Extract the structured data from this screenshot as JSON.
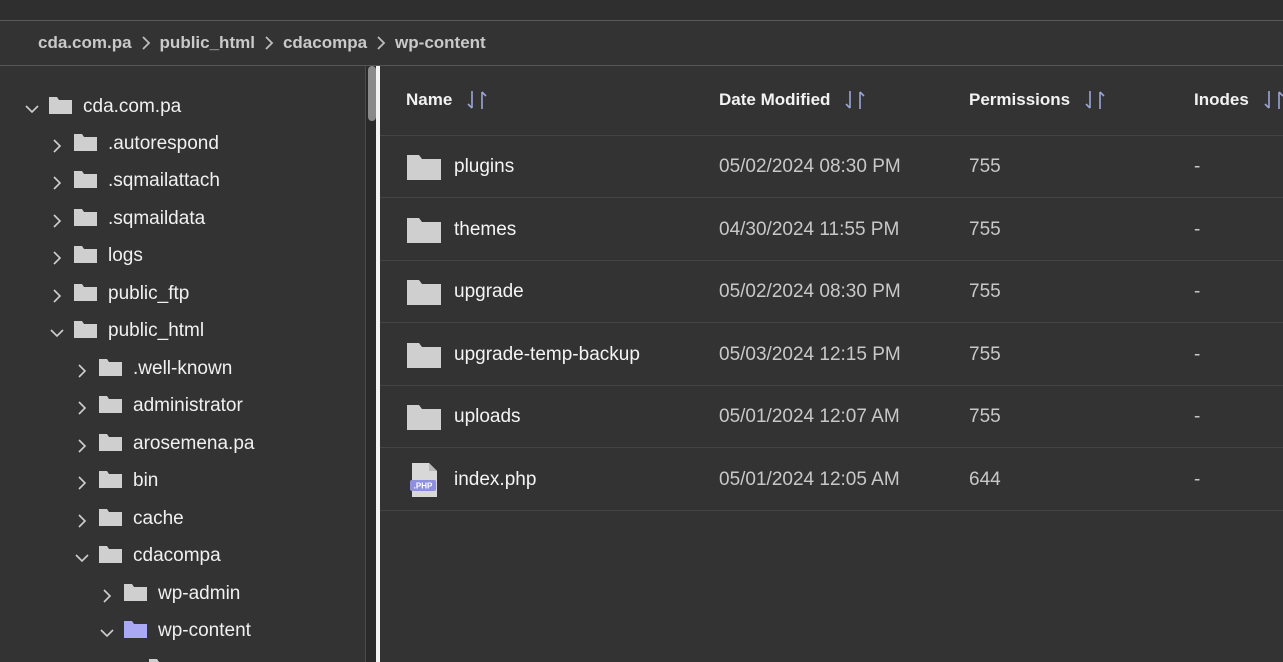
{
  "breadcrumb": [
    {
      "label": "cda.com.pa"
    },
    {
      "label": "public_html"
    },
    {
      "label": "cdacompa"
    },
    {
      "label": "wp-content"
    }
  ],
  "tree": [
    {
      "label": "cda.com.pa",
      "expanded": true
    },
    {
      "label": ".autorespond",
      "expanded": false
    },
    {
      "label": ".sqmailattach",
      "expanded": false
    },
    {
      "label": ".sqmaildata",
      "expanded": false
    },
    {
      "label": "logs",
      "expanded": false
    },
    {
      "label": "public_ftp",
      "expanded": false
    },
    {
      "label": "public_html",
      "expanded": true
    },
    {
      "label": ".well-known",
      "expanded": false
    },
    {
      "label": "administrator",
      "expanded": false
    },
    {
      "label": "arosemena.pa",
      "expanded": false
    },
    {
      "label": "bin",
      "expanded": false
    },
    {
      "label": "cache",
      "expanded": false
    },
    {
      "label": "cdacompa",
      "expanded": true
    },
    {
      "label": "wp-admin",
      "expanded": false
    },
    {
      "label": "wp-content",
      "expanded": true,
      "selected": true
    },
    {
      "label": "",
      "expanded": false
    }
  ],
  "table": {
    "columns": {
      "name": "Name",
      "date": "Date Modified",
      "permissions": "Permissions",
      "inodes": "Inodes"
    },
    "rows": [
      {
        "name": "plugins",
        "date": "05/02/2024 08:30 PM",
        "permissions": "755",
        "inodes": "-",
        "type": "folder"
      },
      {
        "name": "themes",
        "date": "04/30/2024 11:55 PM",
        "permissions": "755",
        "inodes": "-",
        "type": "folder"
      },
      {
        "name": "upgrade",
        "date": "05/02/2024 08:30 PM",
        "permissions": "755",
        "inodes": "-",
        "type": "folder"
      },
      {
        "name": "upgrade-temp-backup",
        "date": "05/03/2024 12:15 PM",
        "permissions": "755",
        "inodes": "-",
        "type": "folder"
      },
      {
        "name": "uploads",
        "date": "05/01/2024 12:07 AM",
        "permissions": "755",
        "inodes": "-",
        "type": "folder"
      },
      {
        "name": "index.php",
        "date": "05/01/2024 12:05 AM",
        "permissions": "644",
        "inodes": "-",
        "type": "php-file",
        "badge": ".PHP"
      }
    ]
  },
  "colors": {
    "folder": "#cfcfcf",
    "folder_selected": "#a9a9f5",
    "php_file": "#d8d8d8",
    "php_badge": "#8f8fe0",
    "sort_icon": "#9aa6d6"
  },
  "icons": {
    "folder": "folder-icon",
    "php": "php-file-icon",
    "sort": "sort-icon",
    "chevron_right": "chevron-right-icon",
    "chevron_down": "chevron-down-icon"
  }
}
